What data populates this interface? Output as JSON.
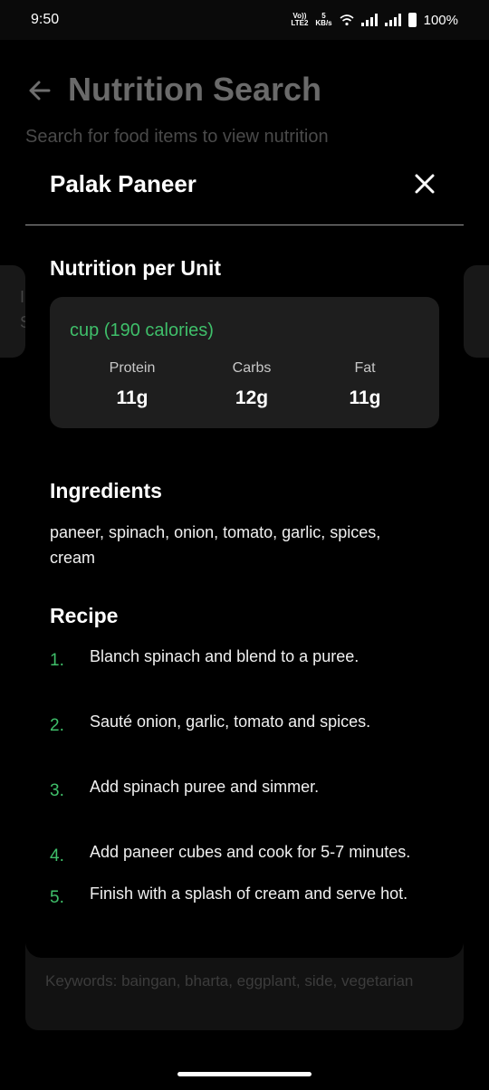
{
  "status_bar": {
    "time": "9:50",
    "net_top": "Vo))",
    "net_bottom": "LTE2",
    "speed_top": "5",
    "speed_bottom": "KB/s",
    "battery": "100%"
  },
  "background_page": {
    "title": "Nutrition Search",
    "subtitle": "Search for food items to view nutrition",
    "card_fragment_1": "I",
    "card_fragment_2": "S",
    "keywords": "Keywords: baingan, bharta, eggplant, side, vegetarian"
  },
  "modal": {
    "title": "Palak Paneer",
    "nutrition_heading": "Nutrition per Unit",
    "unit": "cup (190 calories)",
    "macros": [
      {
        "label": "Protein",
        "value": "11g"
      },
      {
        "label": "Carbs",
        "value": "12g"
      },
      {
        "label": "Fat",
        "value": "11g"
      }
    ],
    "ingredients_heading": "Ingredients",
    "ingredients": "paneer, spinach, onion, tomato, garlic, spices, cream",
    "recipe_heading": "Recipe",
    "steps": [
      {
        "num": "1.",
        "text": "Blanch spinach and blend to a puree."
      },
      {
        "num": "2.",
        "text": "Sauté onion, garlic, tomato and spices."
      },
      {
        "num": "3.",
        "text": "Add spinach puree and simmer."
      },
      {
        "num": "4.",
        "text": "Add paneer cubes and cook for 5-7 minutes."
      },
      {
        "num": "5.",
        "text": "Finish with a splash of cream and serve hot."
      }
    ]
  },
  "colors": {
    "accent_green": "#3fbf6a",
    "card_bg": "#1e1e1e",
    "background": "#000000"
  },
  "icons": [
    "back-arrow-icon",
    "close-icon",
    "wifi-icon",
    "signal-icon",
    "battery-icon"
  ]
}
